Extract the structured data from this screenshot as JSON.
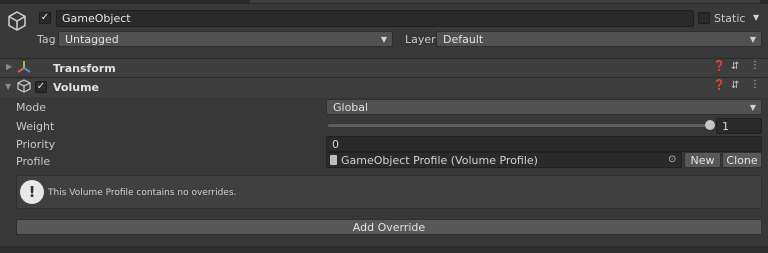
{
  "object": {
    "name": "GameObject",
    "active_checked": true,
    "static_label": "Static",
    "tag_label": "Tag",
    "tag_value": "Untagged",
    "layer_label": "Layer",
    "layer_value": "Default"
  },
  "transform": {
    "title": "Transform"
  },
  "volume": {
    "title": "Volume",
    "enabled": true,
    "mode_label": "Mode",
    "mode_value": "Global",
    "weight_label": "Weight",
    "weight_value": "1",
    "weight_fraction": 1.0,
    "priority_label": "Priority",
    "priority_value": "0",
    "profile_label": "Profile",
    "profile_value": "GameObject Profile (Volume Profile)",
    "new_button": "New",
    "clone_button": "Clone",
    "info_message": "This Volume Profile contains no overrides.",
    "add_override_button": "Add Override"
  },
  "icons": {
    "gameobject": "cube-outline-icon",
    "help": "help-icon",
    "presets": "presets-icon",
    "menu": "kebab-menu-icon",
    "transform": "transform-axes-icon",
    "volume": "volume-box-icon",
    "object_picker": "object-picker-icon",
    "info": "exclamation-icon",
    "asset": "asset-file-icon"
  }
}
